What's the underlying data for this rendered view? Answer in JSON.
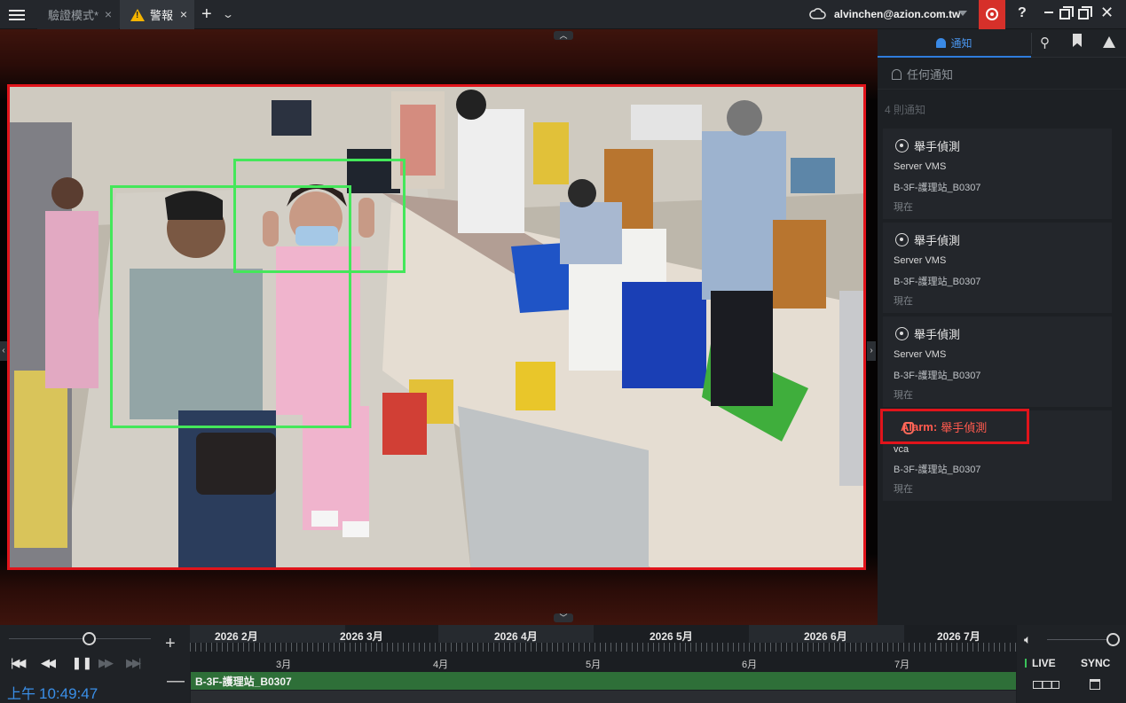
{
  "topbar": {
    "tabs": [
      {
        "label": "驗證模式*",
        "close": "×"
      },
      {
        "label": "警報",
        "close": "×"
      }
    ],
    "add_tab": "+",
    "tab_menu": "⌄",
    "account": "alvinchen@azion.com.tw",
    "help": "?̶"
  },
  "panel": {
    "tab_notice": "通知",
    "filter": "任何通知",
    "count": "4 則通知",
    "notifications": [
      {
        "title": "舉手偵測",
        "source": "Server VMS",
        "camera": "B-3F-護理站_B0307",
        "time": "現在"
      },
      {
        "title": "舉手偵測",
        "source": "Server VMS",
        "camera": "B-3F-護理站_B0307",
        "time": "現在"
      },
      {
        "title": "舉手偵測",
        "source": "Server VMS",
        "camera": "B-3F-護理站_B0307",
        "time": "現在"
      },
      {
        "alarm_prefix": "Alarm:",
        "title": "舉手偵測",
        "source": "vca",
        "camera": "B-3F-護理站_B0307",
        "time": "現在"
      }
    ]
  },
  "playback": {
    "clock_ampm": "上午",
    "clock_time": "10:49:47"
  },
  "timeline": {
    "top_months": [
      "2026 2月",
      "2026 3月",
      "2026 4月",
      "2026 5月",
      "2026 6月",
      "2026 7月"
    ],
    "bottom_months": [
      "3月",
      "4月",
      "5月",
      "6月",
      "7月"
    ],
    "track_label": "B-3F-護理站_B0307"
  },
  "controls": {
    "live": "LIVE",
    "sync": "SYNC"
  },
  "colors": {
    "accent_blue": "#2f7ddc",
    "alarm_red": "#e1141b",
    "record_red": "#d6302a",
    "detection_green": "#44e75a",
    "track_green": "#2e6f38"
  },
  "icons": [
    "menu-icon",
    "warning-icon",
    "cloud-icon",
    "record-icon",
    "help-icon",
    "restore-icon",
    "close-x-icon",
    "bell-icon",
    "motion-icon",
    "bookmark-icon",
    "alert-icon",
    "hand-icon",
    "volume-icon",
    "calendar-icon"
  ]
}
